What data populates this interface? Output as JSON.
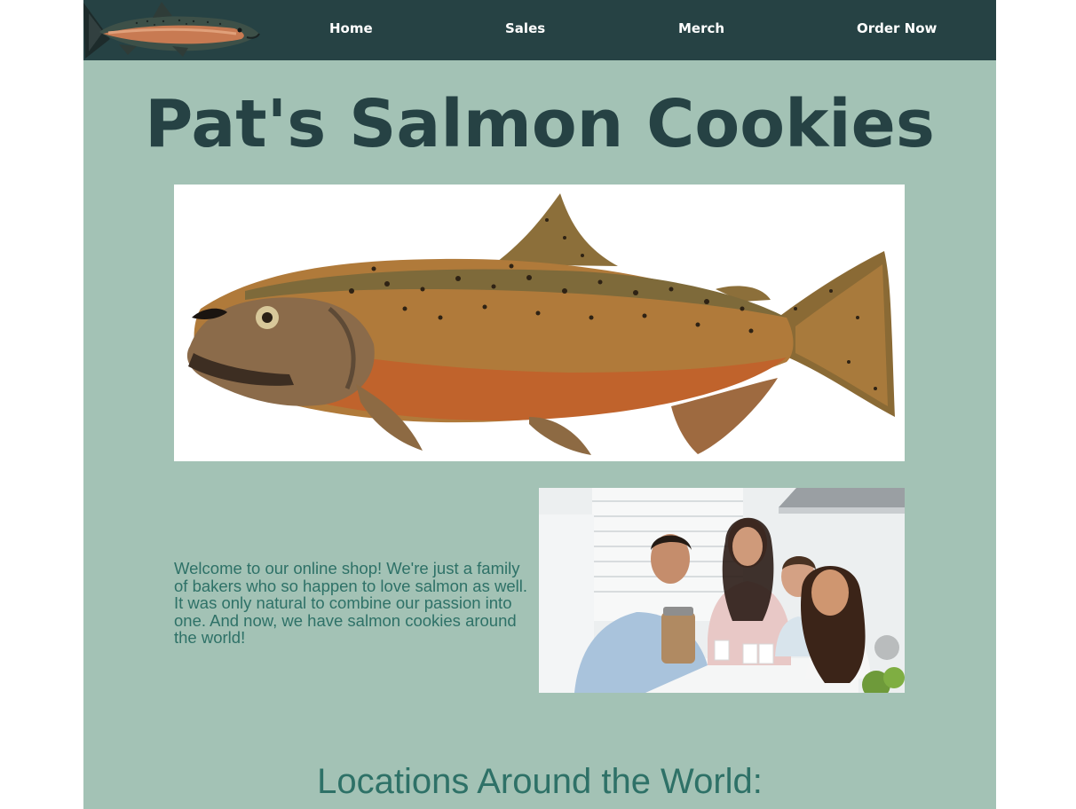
{
  "nav": {
    "logo_icon": "salmon-icon",
    "items": [
      {
        "label": "Home"
      },
      {
        "label": "Sales"
      },
      {
        "label": "Merch"
      },
      {
        "label": "Order Now"
      }
    ]
  },
  "main": {
    "title": "Pat's Salmon Cookies",
    "hero_image": "salmon-illustration",
    "welcome_text": "Welcome to our online shop! We're just a family of bakers who so happen to love salmon as well. It was only natural to combine our passion into one. And now, we have salmon cookies around the world!",
    "family_photo": "family-photo",
    "locations_heading": "Locations Around the World:"
  },
  "colors": {
    "nav_bg": "#264244",
    "page_bg": "#a3c2b5",
    "title": "#264244",
    "body_text": "#2e7167"
  }
}
